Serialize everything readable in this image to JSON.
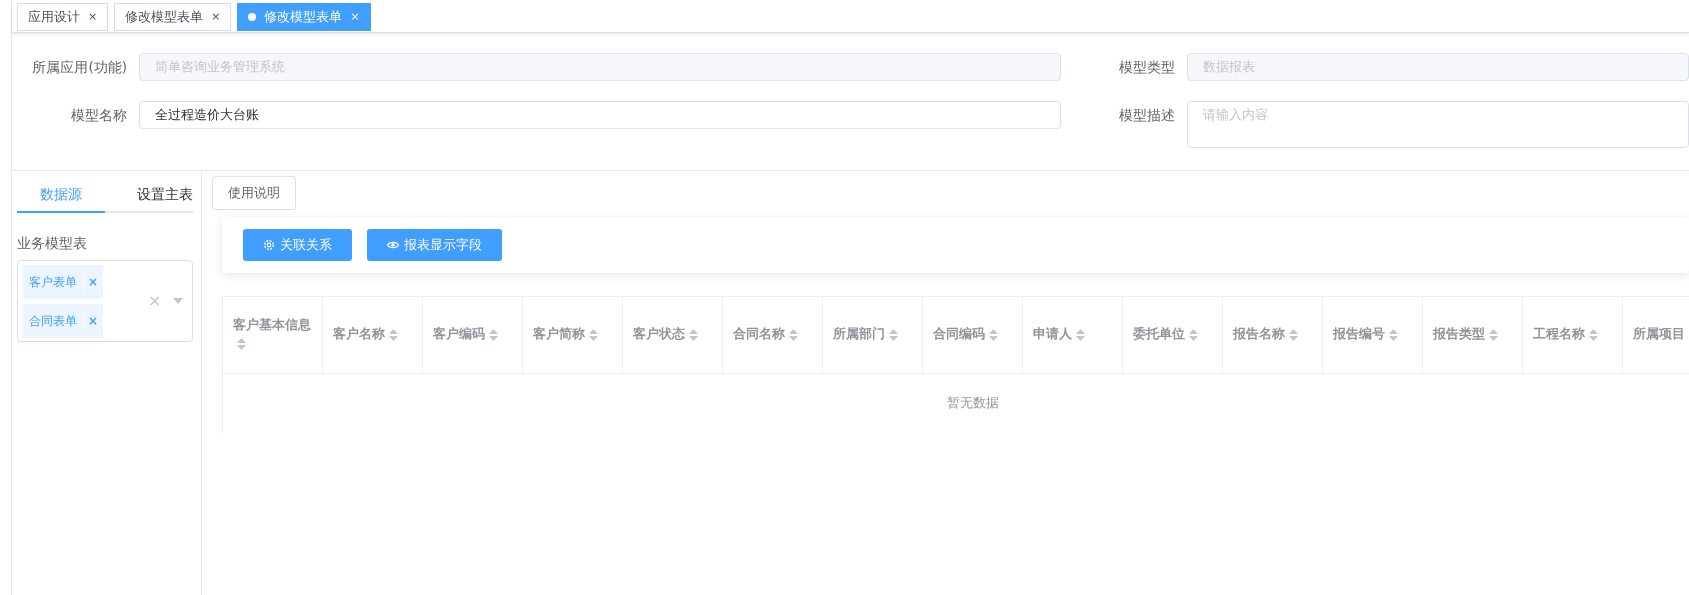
{
  "tabs": [
    {
      "label": "应用设计",
      "selected": false,
      "close": "×"
    },
    {
      "label": "修改模型表单",
      "selected": false,
      "close": "×"
    },
    {
      "label": "修改模型表单",
      "selected": true,
      "close": "×"
    }
  ],
  "form": {
    "app_label": "所属应用(功能)",
    "app_value": "简单咨询业务管理系统",
    "type_label": "模型类型",
    "type_value": "数据报表",
    "name_label": "模型名称",
    "name_value": "全过程造价大台账",
    "desc_label": "模型描述",
    "desc_placeholder": "请输入内容"
  },
  "side_tabs": [
    {
      "label": "数据源",
      "selected": true
    },
    {
      "label": "设置主表",
      "selected": false
    }
  ],
  "model_table_label": "业务模型表",
  "model_tags": [
    {
      "label": "客户表单",
      "remove": "×"
    },
    {
      "label": "合同表单",
      "remove": "×"
    }
  ],
  "select_clear": "×",
  "help_button": "使用说明",
  "toolbar_buttons": [
    {
      "label": "关联关系",
      "kind": "gear"
    },
    {
      "label": "报表显示字段",
      "kind": "eye"
    }
  ],
  "table": {
    "columns": [
      {
        "label": "客户基本信息",
        "sortable": true
      },
      {
        "label": "客户名称",
        "sortable": true
      },
      {
        "label": "客户编码",
        "sortable": true
      },
      {
        "label": "客户简称",
        "sortable": true
      },
      {
        "label": "客户状态",
        "sortable": true
      },
      {
        "label": "合同名称",
        "sortable": true
      },
      {
        "label": "所属部门",
        "sortable": true
      },
      {
        "label": "合同编码",
        "sortable": true
      },
      {
        "label": "申请人",
        "sortable": true
      },
      {
        "label": "委托单位",
        "sortable": true
      },
      {
        "label": "报告名称",
        "sortable": true
      },
      {
        "label": "报告编号",
        "sortable": true
      },
      {
        "label": "报告类型",
        "sortable": true
      },
      {
        "label": "工程名称",
        "sortable": true
      },
      {
        "label": "所属项目"
      }
    ],
    "empty_text": "暂无数据"
  }
}
